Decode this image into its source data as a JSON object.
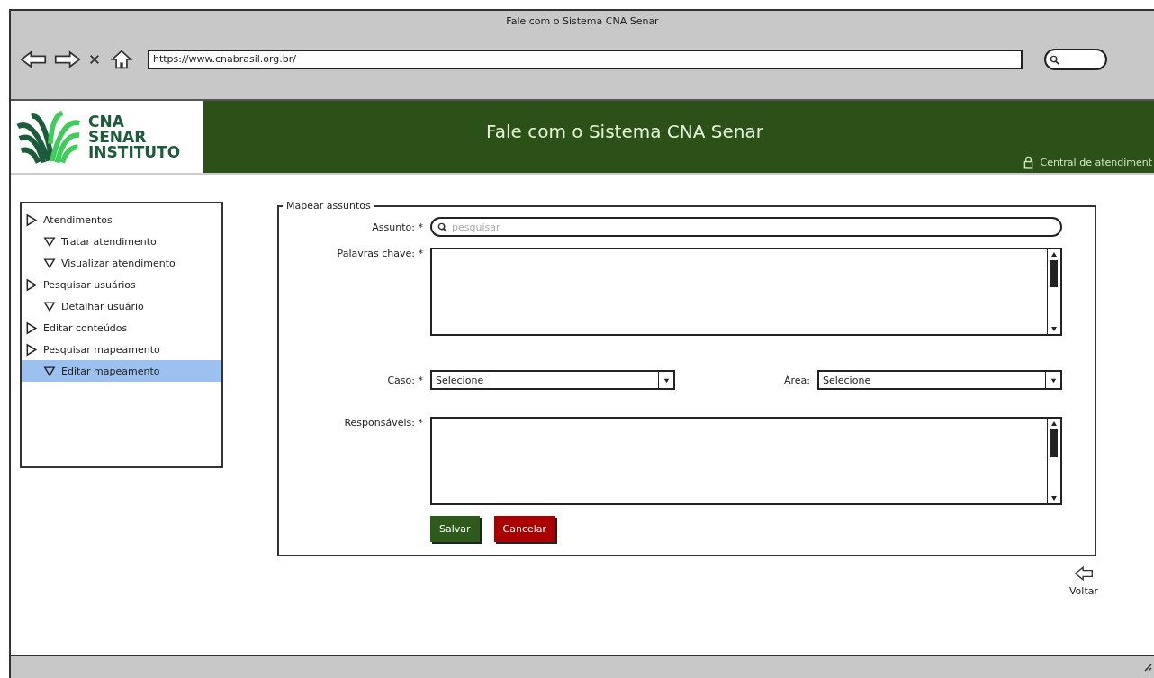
{
  "window": {
    "title": "Fale com o Sistema CNA Senar"
  },
  "browser": {
    "url": "https://www.cnabrasil.org.br/"
  },
  "header": {
    "logo_lines": [
      "CNA",
      "SENAR",
      "INSTITUTO"
    ],
    "title": "Fale com o Sistema CNA Senar",
    "link": "Central de atendiment"
  },
  "sidebar": {
    "items": [
      {
        "label": "Atendimentos",
        "selected": false,
        "children": [
          {
            "label": "Tratar atendimento",
            "selected": false
          },
          {
            "label": "Visualizar atendimento",
            "selected": false
          }
        ]
      },
      {
        "label": "Pesquisar usuários",
        "selected": false,
        "children": [
          {
            "label": "Detalhar usuário",
            "selected": false
          }
        ]
      },
      {
        "label": "Editar conteúdos",
        "selected": false
      },
      {
        "label": "Pesquisar mapeamento",
        "selected": false,
        "children": [
          {
            "label": "Editar mapeamento",
            "selected": true
          }
        ]
      }
    ]
  },
  "form": {
    "legend": "Mapear assuntos",
    "assunto": {
      "label": "Assunto:",
      "required": "*",
      "placeholder": "pesquisar"
    },
    "palavras": {
      "label": "Palavras chave:",
      "required": "*"
    },
    "caso": {
      "label": "Caso:",
      "required": "*",
      "value": "Selecione"
    },
    "area": {
      "label": "Área:",
      "value": "Selecione"
    },
    "responsaveis": {
      "label": "Responsáveis:",
      "required": "*"
    },
    "buttons": [
      {
        "label": "Salvar",
        "kind": "primary"
      },
      {
        "label": "Cancelar",
        "kind": "danger"
      }
    ]
  },
  "back": {
    "label": "Voltar"
  }
}
